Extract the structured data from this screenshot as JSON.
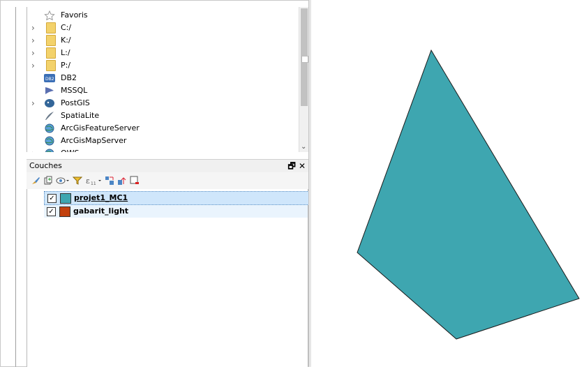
{
  "browser": {
    "items": [
      {
        "label": "Favoris",
        "icon": "star-icon",
        "expandable": false
      },
      {
        "label": "C:/",
        "icon": "folder-icon",
        "expandable": true
      },
      {
        "label": "K:/",
        "icon": "folder-icon",
        "expandable": true
      },
      {
        "label": "L:/",
        "icon": "folder-icon",
        "expandable": true
      },
      {
        "label": "P:/",
        "icon": "folder-icon",
        "expandable": true
      },
      {
        "label": "DB2",
        "icon": "db2-icon",
        "expandable": false
      },
      {
        "label": "MSSQL",
        "icon": "mssql-icon",
        "expandable": false
      },
      {
        "label": "PostGIS",
        "icon": "postgis-icon",
        "expandable": true
      },
      {
        "label": "SpatiaLite",
        "icon": "spatialite-icon",
        "expandable": false
      },
      {
        "label": "ArcGisFeatureServer",
        "icon": "globe-icon",
        "expandable": false
      },
      {
        "label": "ArcGisMapServer",
        "icon": "globe-icon",
        "expandable": false
      },
      {
        "label": "OWS",
        "icon": "globe-icon",
        "expandable": true
      }
    ],
    "db2_icon_text": "DB2"
  },
  "layers_panel": {
    "title": "Couches",
    "float_glyph": "🗗",
    "close_glyph": "✕",
    "layers": [
      {
        "name": "projet1_MC1",
        "color": "#3ea6b0",
        "checked": true,
        "selected": true
      },
      {
        "name": "gabarit_light",
        "color": "#c2410e",
        "checked": true,
        "selected": false
      }
    ]
  },
  "map": {
    "polygon_fill": "#3ea6b0",
    "polygon_stroke": "#1a1a1a"
  }
}
